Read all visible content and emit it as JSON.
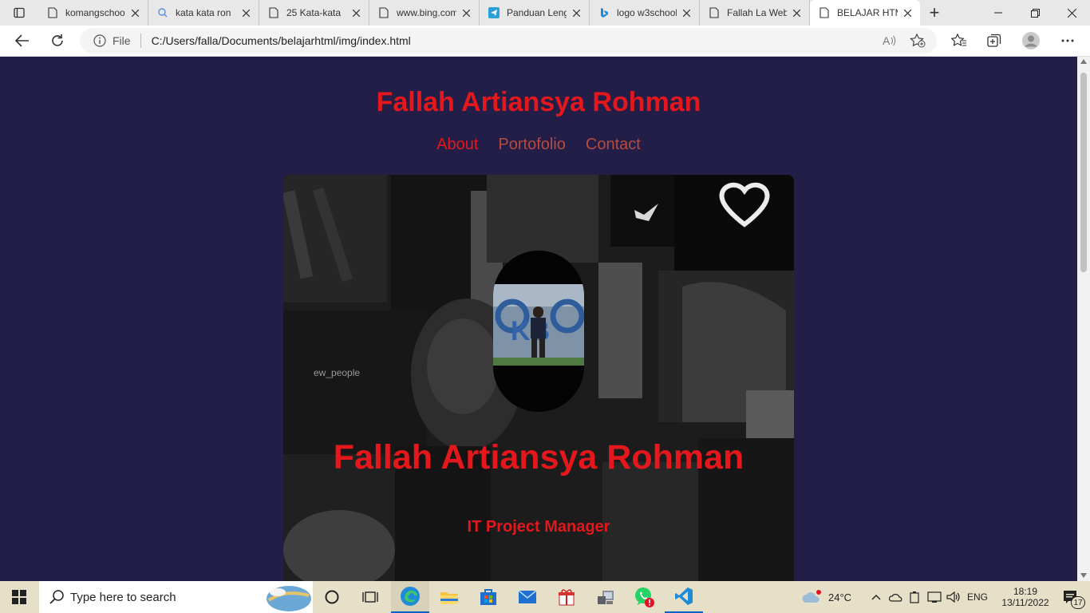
{
  "browser": {
    "tabs": [
      {
        "title": "komangschool",
        "icon": "page-icon"
      },
      {
        "title": "kata kata ron",
        "icon": "search-icon"
      },
      {
        "title": "25 Kata-kata",
        "icon": "page-icon"
      },
      {
        "title": "www.bing.com",
        "icon": "page-icon"
      },
      {
        "title": "Panduan Leng",
        "icon": "telegram-icon"
      },
      {
        "title": "logo w3school",
        "icon": "bing-icon"
      },
      {
        "title": "Fallah La Web",
        "icon": "page-icon"
      },
      {
        "title": "BELAJAR HTML",
        "icon": "page-icon"
      }
    ],
    "active_tab_index": 7,
    "new_tab_symbol": "+",
    "address": {
      "scheme_label": "File",
      "url": "C:/Users/falla/Documents/belajarhtml/img/index.html"
    }
  },
  "page": {
    "site_title": "Fallah Artiansya Rohman",
    "nav": [
      {
        "label": "About",
        "color": "#e4181c"
      },
      {
        "label": "Portofolio",
        "color": "#b84a3e"
      },
      {
        "label": "Contact",
        "color": "#b84a3e"
      }
    ],
    "hero": {
      "name": "Fallah Artiansya Rohman",
      "role": "IT Project Manager",
      "photo_text": "ew_people",
      "avatar_text": "KB"
    }
  },
  "taskbar": {
    "search_placeholder": "Type here to search",
    "weather": "24°C",
    "language": "ENG",
    "time": "18:19",
    "date": "13/11/2022",
    "notification_count": "17"
  },
  "colors": {
    "page_bg": "#221e47",
    "accent_red": "#e4181c",
    "nav_muted": "#b84a3e",
    "taskbar_bg": "#e6e0c8"
  }
}
